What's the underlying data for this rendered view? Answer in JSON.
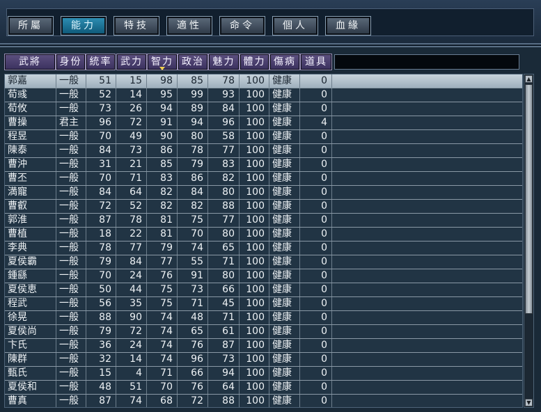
{
  "tabs": [
    {
      "label": "所屬",
      "active": false
    },
    {
      "label": "能力",
      "active": true
    },
    {
      "label": "特技",
      "active": false
    },
    {
      "label": "適性",
      "active": false
    },
    {
      "label": "命令",
      "active": false
    },
    {
      "label": "個人",
      "active": false
    },
    {
      "label": "血緣",
      "active": false
    }
  ],
  "columns": [
    "武將",
    "身份",
    "統率",
    "武力",
    "智力",
    "政治",
    "魅力",
    "體力",
    "傷病",
    "道具"
  ],
  "sorted_column": "智力",
  "rows": [
    [
      "郭嘉",
      "一般",
      "51",
      "15",
      "98",
      "85",
      "78",
      "100",
      "健康",
      "0"
    ],
    [
      "荀彧",
      "一般",
      "52",
      "14",
      "95",
      "99",
      "93",
      "100",
      "健康",
      "0"
    ],
    [
      "荀攸",
      "一般",
      "73",
      "26",
      "94",
      "89",
      "84",
      "100",
      "健康",
      "0"
    ],
    [
      "曹操",
      "君主",
      "96",
      "72",
      "91",
      "94",
      "96",
      "100",
      "健康",
      "4"
    ],
    [
      "程昱",
      "一般",
      "70",
      "49",
      "90",
      "80",
      "58",
      "100",
      "健康",
      "0"
    ],
    [
      "陳泰",
      "一般",
      "84",
      "73",
      "86",
      "78",
      "77",
      "100",
      "健康",
      "0"
    ],
    [
      "曹沖",
      "一般",
      "31",
      "21",
      "85",
      "79",
      "83",
      "100",
      "健康",
      "0"
    ],
    [
      "曹丕",
      "一般",
      "70",
      "71",
      "83",
      "86",
      "82",
      "100",
      "健康",
      "0"
    ],
    [
      "満寵",
      "一般",
      "84",
      "64",
      "82",
      "84",
      "80",
      "100",
      "健康",
      "0"
    ],
    [
      "曹叡",
      "一般",
      "72",
      "52",
      "82",
      "82",
      "88",
      "100",
      "健康",
      "0"
    ],
    [
      "郭淮",
      "一般",
      "87",
      "78",
      "81",
      "75",
      "77",
      "100",
      "健康",
      "0"
    ],
    [
      "曹植",
      "一般",
      "18",
      "22",
      "81",
      "70",
      "80",
      "100",
      "健康",
      "0"
    ],
    [
      "李典",
      "一般",
      "78",
      "77",
      "79",
      "74",
      "65",
      "100",
      "健康",
      "0"
    ],
    [
      "夏侯霸",
      "一般",
      "79",
      "84",
      "77",
      "55",
      "71",
      "100",
      "健康",
      "0"
    ],
    [
      "鍾繇",
      "一般",
      "70",
      "24",
      "76",
      "91",
      "80",
      "100",
      "健康",
      "0"
    ],
    [
      "夏侯恵",
      "一般",
      "50",
      "44",
      "75",
      "73",
      "66",
      "100",
      "健康",
      "0"
    ],
    [
      "程武",
      "一般",
      "56",
      "35",
      "75",
      "71",
      "45",
      "100",
      "健康",
      "0"
    ],
    [
      "徐晃",
      "一般",
      "88",
      "90",
      "74",
      "48",
      "71",
      "100",
      "健康",
      "0"
    ],
    [
      "夏侯尚",
      "一般",
      "79",
      "72",
      "74",
      "65",
      "61",
      "100",
      "健康",
      "0"
    ],
    [
      "卞氏",
      "一般",
      "36",
      "24",
      "74",
      "76",
      "87",
      "100",
      "健康",
      "0"
    ],
    [
      "陳群",
      "一般",
      "32",
      "14",
      "74",
      "96",
      "73",
      "100",
      "健康",
      "0"
    ],
    [
      "甄氏",
      "一般",
      "15",
      "4",
      "71",
      "66",
      "94",
      "100",
      "健康",
      "0"
    ],
    [
      "夏侯和",
      "一般",
      "48",
      "51",
      "70",
      "76",
      "64",
      "100",
      "健康",
      "0"
    ],
    [
      "曹真",
      "一般",
      "87",
      "74",
      "68",
      "72",
      "88",
      "100",
      "健康",
      "0"
    ]
  ],
  "selected_row": 0,
  "icons": {
    "scroll_up": "▲",
    "scroll_down": "▼"
  },
  "colors": {
    "active_tab": "#1f7fa6",
    "header": "#4a3f70",
    "selected_row": "#b4c3ce"
  }
}
